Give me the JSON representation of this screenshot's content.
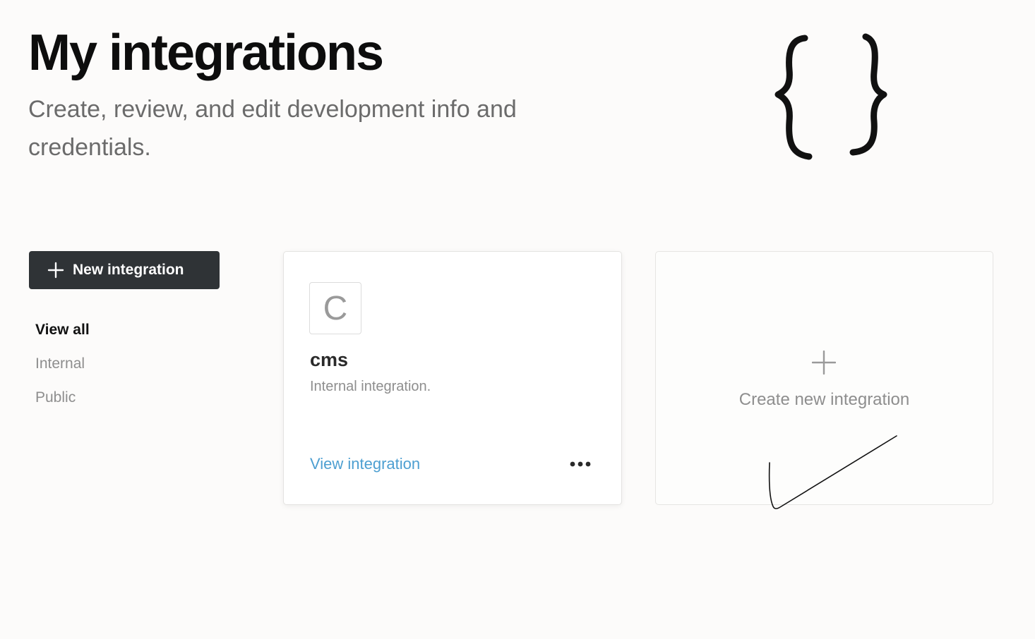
{
  "header": {
    "title": "My integrations",
    "subtitle": "Create, review, and edit development info and credentials."
  },
  "sidebar": {
    "new_button_label": "New integration",
    "filters": [
      {
        "label": "View all",
        "active": true
      },
      {
        "label": "Internal",
        "active": false
      },
      {
        "label": "Public",
        "active": false
      }
    ]
  },
  "integrations": [
    {
      "initial": "C",
      "name": "cms",
      "description": "Internal integration.",
      "link_label": "View integration"
    }
  ],
  "create_card": {
    "label": "Create new integration"
  },
  "icons": {
    "hero": "curly-braces-icon",
    "new": "plus-icon",
    "more": "more-horizontal-icon",
    "create": "plus-icon",
    "annotation": "checkmark-icon"
  },
  "colors": {
    "background": "#fcfbfa",
    "button": "#2f3336",
    "link": "#4d9fd1",
    "muted": "#8e8e8e"
  }
}
